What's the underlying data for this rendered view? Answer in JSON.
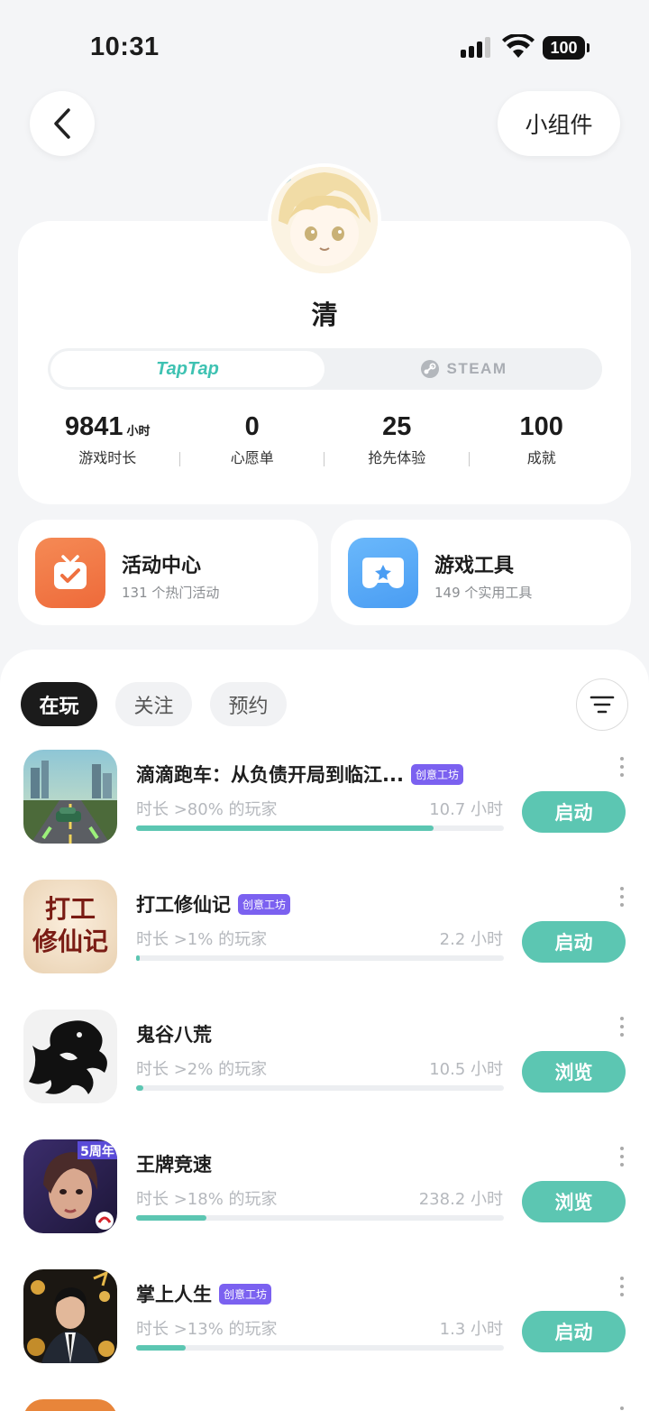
{
  "status_bar": {
    "time": "10:31",
    "battery": "100"
  },
  "header": {
    "widget_label": "小组件"
  },
  "profile": {
    "name": "清",
    "platforms": {
      "active": "TapTap",
      "inactive": "STEAM"
    },
    "stats": [
      {
        "value": "9841",
        "unit": "小时",
        "label": "游戏时长"
      },
      {
        "value": "0",
        "unit": "",
        "label": "心愿单"
      },
      {
        "value": "25",
        "unit": "",
        "label": "抢先体验"
      },
      {
        "value": "100",
        "unit": "",
        "label": "成就"
      }
    ]
  },
  "features": [
    {
      "title": "活动中心",
      "subtitle": "131 个热门活动",
      "color": "#f07a45"
    },
    {
      "title": "游戏工具",
      "subtitle": "149 个实用工具",
      "color": "#5aaaf5"
    }
  ],
  "tabs": [
    "在玩",
    "关注",
    "预约"
  ],
  "games": [
    {
      "name": "滴滴跑车：从负债开局到临江...",
      "badge": "创意工坊",
      "pct_text": "时长 >80% 的玩家",
      "hours": "10.7 小时",
      "progress": 0.81,
      "action": "启动"
    },
    {
      "name": "打工修仙记",
      "badge": "创意工坊",
      "pct_text": "时长 >1% 的玩家",
      "hours": "2.2 小时",
      "progress": 0.01,
      "action": "启动",
      "icon_text": "打工修仙记"
    },
    {
      "name": "鬼谷八荒",
      "badge": "",
      "pct_text": "时长 >2% 的玩家",
      "hours": "10.5 小时",
      "progress": 0.02,
      "action": "浏览"
    },
    {
      "name": "王牌竞速",
      "badge": "",
      "pct_text": "时长 >18% 的玩家",
      "hours": "238.2 小时",
      "progress": 0.19,
      "action": "浏览",
      "icon_text": "5周年"
    },
    {
      "name": "掌上人生",
      "badge": "创意工坊",
      "pct_text": "时长 >13% 的玩家",
      "hours": "1.3 小时",
      "progress": 0.135,
      "action": "启动"
    }
  ],
  "colors": {
    "accent": "#5cc6b2",
    "badge": "#7b61f0",
    "taptap": "#3ec2b2"
  }
}
